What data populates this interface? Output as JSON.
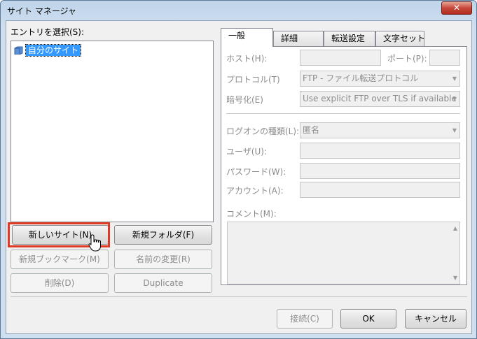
{
  "window": {
    "title": "サイト マネージャ",
    "close_glyph": "✕"
  },
  "left": {
    "entry_label": "エントリを選択(S):",
    "tree_item": "自分のサイト",
    "buttons": {
      "new_site": "新しいサイト(N)",
      "new_folder": "新規フォルダ(F)",
      "new_bookmark": "新規ブックマーク(M)",
      "rename": "名前の変更(R)",
      "delete": "削除(D)",
      "duplicate": "Duplicate"
    }
  },
  "tabs": [
    {
      "label": "一般"
    },
    {
      "label": "詳細"
    },
    {
      "label": "転送設定"
    },
    {
      "label": "文字セット"
    }
  ],
  "general": {
    "host_label": "ホスト(H):",
    "port_label": "ポート(P):",
    "protocol_label": "プロトコル(T)",
    "protocol_value": "FTP - ファイル転送プロトコル",
    "encryption_label": "暗号化(E)",
    "encryption_value": "Use explicit FTP over TLS if available",
    "logon_label": "ログオンの種類(L):",
    "logon_value": "匿名",
    "user_label": "ユーザ(U):",
    "password_label": "パスワード(W):",
    "account_label": "アカウント(A):",
    "comment_label": "コメント(M):"
  },
  "bottom": {
    "connect": "接続(C)",
    "ok": "OK",
    "cancel": "キャンセル"
  },
  "colors": {
    "highlight": "#e03a24",
    "selection": "#3399ff"
  },
  "icons": {
    "tree_item": "folder-icon",
    "pointer": "hand-cursor-icon"
  }
}
